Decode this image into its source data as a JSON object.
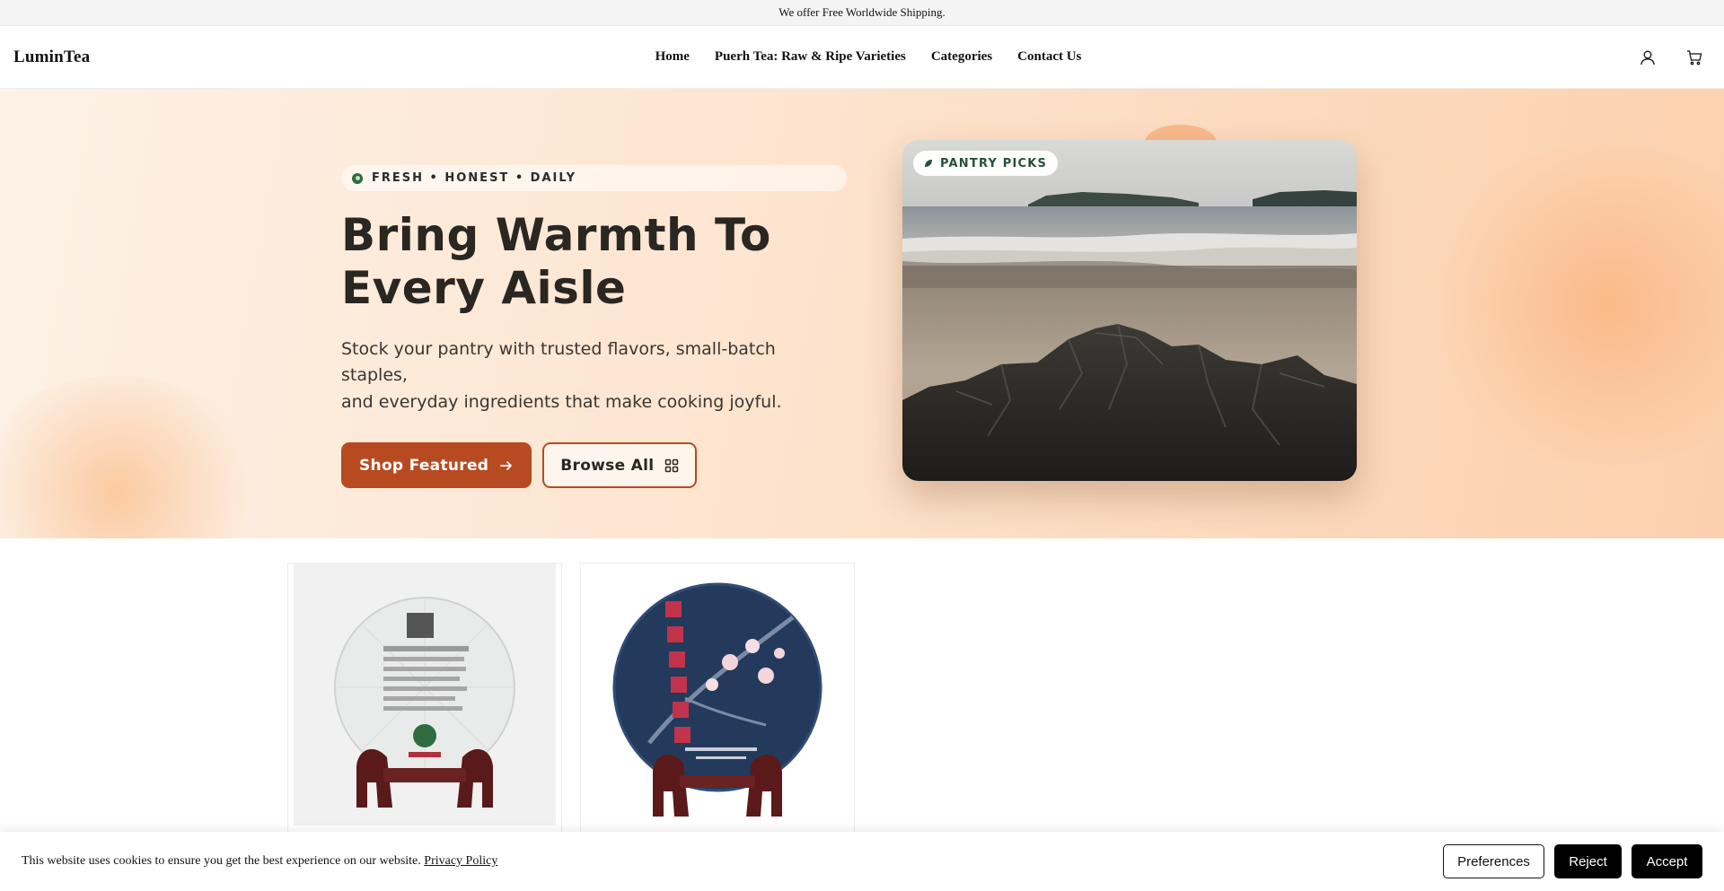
{
  "announcement": "We offer Free Worldwide Shipping.",
  "header": {
    "logo": "LuminTea",
    "nav": [
      "Home",
      "Puerh Tea: Raw & Ripe Varieties",
      "Categories",
      "Contact Us"
    ],
    "icons": [
      "account-icon",
      "cart-icon"
    ]
  },
  "hero": {
    "eyebrow": "FRESH • HONEST • DAILY",
    "title_line1": "Bring Warmth To",
    "title_line2": "Every Aisle",
    "description_line1": "Stock your pantry with trusted flavors, small-batch staples,",
    "description_line2": "and everyday ingredients that make cooking joyful.",
    "primary_cta": "Shop Featured",
    "secondary_cta": "Browse All",
    "badge": "PANTRY PICKS",
    "accent_color": "#b84a22",
    "badge_color": "#24503a"
  },
  "cookie": {
    "text": "This website uses cookies to ensure you get the best experience on our website.",
    "link": "Privacy Policy",
    "preferences": "Preferences",
    "reject": "Reject",
    "accept": "Accept"
  }
}
